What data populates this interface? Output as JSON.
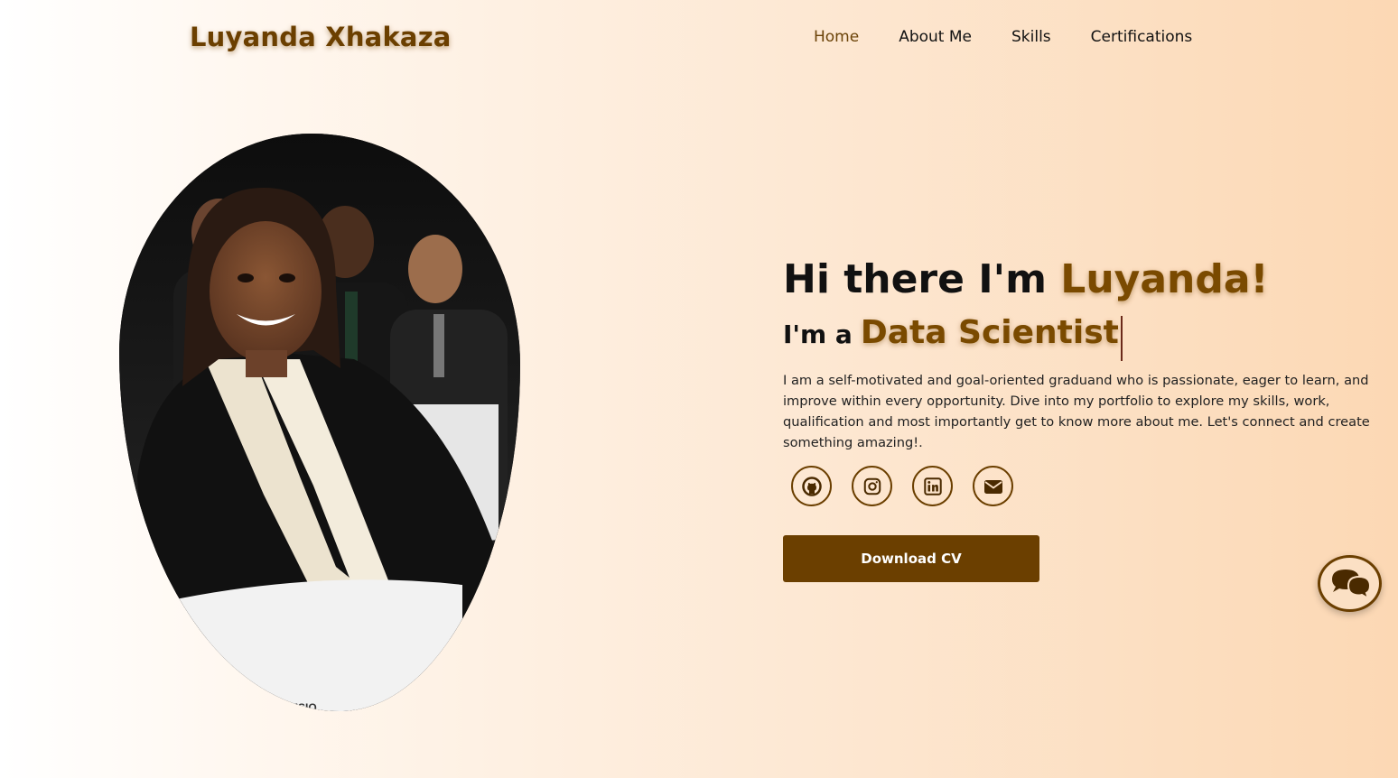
{
  "site": {
    "logo": "Luyanda Xhakaza"
  },
  "nav": {
    "items": [
      {
        "label": "Home",
        "active": true
      },
      {
        "label": "About Me",
        "active": false
      },
      {
        "label": "Skills",
        "active": false
      },
      {
        "label": "Certifications",
        "active": false
      }
    ]
  },
  "hero": {
    "greeting_prefix": "Hi there I'm ",
    "greeting_name": "Luyanda!",
    "role_prefix": "I'm a",
    "role": "Data Scientist",
    "bio": "I am a self-motivated and goal-oriented graduand who is passionate, eager to learn, and improve within every opportunity. Dive into my portfolio to explore my skills, work, qualification and most importantly get to know more about me. Let's connect and create something amazing!.",
    "photo_caption": "ENVISIO",
    "cv_button": "Download CV"
  },
  "socials": [
    {
      "icon": "github-icon"
    },
    {
      "icon": "instagram-icon"
    },
    {
      "icon": "linkedin-icon"
    },
    {
      "icon": "email-icon"
    }
  ],
  "chat": {
    "icon": "chat-bubbles-icon"
  },
  "colors": {
    "accent": "#6b3f00",
    "accent_text": "#7a4a00",
    "background_end": "#fcd8b4"
  }
}
